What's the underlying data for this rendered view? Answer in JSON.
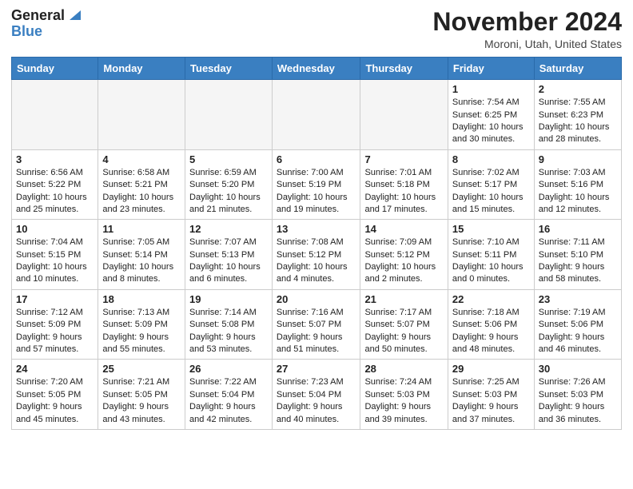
{
  "header": {
    "logo_line1": "General",
    "logo_line2": "Blue",
    "month": "November 2024",
    "location": "Moroni, Utah, United States"
  },
  "weekdays": [
    "Sunday",
    "Monday",
    "Tuesday",
    "Wednesday",
    "Thursday",
    "Friday",
    "Saturday"
  ],
  "weeks": [
    [
      {
        "day": "",
        "text": "",
        "empty": true
      },
      {
        "day": "",
        "text": "",
        "empty": true
      },
      {
        "day": "",
        "text": "",
        "empty": true
      },
      {
        "day": "",
        "text": "",
        "empty": true
      },
      {
        "day": "",
        "text": "",
        "empty": true
      },
      {
        "day": "1",
        "text": "Sunrise: 7:54 AM\nSunset: 6:25 PM\nDaylight: 10 hours and 30 minutes.",
        "empty": false
      },
      {
        "day": "2",
        "text": "Sunrise: 7:55 AM\nSunset: 6:23 PM\nDaylight: 10 hours and 28 minutes.",
        "empty": false
      }
    ],
    [
      {
        "day": "3",
        "text": "Sunrise: 6:56 AM\nSunset: 5:22 PM\nDaylight: 10 hours and 25 minutes.",
        "empty": false
      },
      {
        "day": "4",
        "text": "Sunrise: 6:58 AM\nSunset: 5:21 PM\nDaylight: 10 hours and 23 minutes.",
        "empty": false
      },
      {
        "day": "5",
        "text": "Sunrise: 6:59 AM\nSunset: 5:20 PM\nDaylight: 10 hours and 21 minutes.",
        "empty": false
      },
      {
        "day": "6",
        "text": "Sunrise: 7:00 AM\nSunset: 5:19 PM\nDaylight: 10 hours and 19 minutes.",
        "empty": false
      },
      {
        "day": "7",
        "text": "Sunrise: 7:01 AM\nSunset: 5:18 PM\nDaylight: 10 hours and 17 minutes.",
        "empty": false
      },
      {
        "day": "8",
        "text": "Sunrise: 7:02 AM\nSunset: 5:17 PM\nDaylight: 10 hours and 15 minutes.",
        "empty": false
      },
      {
        "day": "9",
        "text": "Sunrise: 7:03 AM\nSunset: 5:16 PM\nDaylight: 10 hours and 12 minutes.",
        "empty": false
      }
    ],
    [
      {
        "day": "10",
        "text": "Sunrise: 7:04 AM\nSunset: 5:15 PM\nDaylight: 10 hours and 10 minutes.",
        "empty": false
      },
      {
        "day": "11",
        "text": "Sunrise: 7:05 AM\nSunset: 5:14 PM\nDaylight: 10 hours and 8 minutes.",
        "empty": false
      },
      {
        "day": "12",
        "text": "Sunrise: 7:07 AM\nSunset: 5:13 PM\nDaylight: 10 hours and 6 minutes.",
        "empty": false
      },
      {
        "day": "13",
        "text": "Sunrise: 7:08 AM\nSunset: 5:12 PM\nDaylight: 10 hours and 4 minutes.",
        "empty": false
      },
      {
        "day": "14",
        "text": "Sunrise: 7:09 AM\nSunset: 5:12 PM\nDaylight: 10 hours and 2 minutes.",
        "empty": false
      },
      {
        "day": "15",
        "text": "Sunrise: 7:10 AM\nSunset: 5:11 PM\nDaylight: 10 hours and 0 minutes.",
        "empty": false
      },
      {
        "day": "16",
        "text": "Sunrise: 7:11 AM\nSunset: 5:10 PM\nDaylight: 9 hours and 58 minutes.",
        "empty": false
      }
    ],
    [
      {
        "day": "17",
        "text": "Sunrise: 7:12 AM\nSunset: 5:09 PM\nDaylight: 9 hours and 57 minutes.",
        "empty": false
      },
      {
        "day": "18",
        "text": "Sunrise: 7:13 AM\nSunset: 5:09 PM\nDaylight: 9 hours and 55 minutes.",
        "empty": false
      },
      {
        "day": "19",
        "text": "Sunrise: 7:14 AM\nSunset: 5:08 PM\nDaylight: 9 hours and 53 minutes.",
        "empty": false
      },
      {
        "day": "20",
        "text": "Sunrise: 7:16 AM\nSunset: 5:07 PM\nDaylight: 9 hours and 51 minutes.",
        "empty": false
      },
      {
        "day": "21",
        "text": "Sunrise: 7:17 AM\nSunset: 5:07 PM\nDaylight: 9 hours and 50 minutes.",
        "empty": false
      },
      {
        "day": "22",
        "text": "Sunrise: 7:18 AM\nSunset: 5:06 PM\nDaylight: 9 hours and 48 minutes.",
        "empty": false
      },
      {
        "day": "23",
        "text": "Sunrise: 7:19 AM\nSunset: 5:06 PM\nDaylight: 9 hours and 46 minutes.",
        "empty": false
      }
    ],
    [
      {
        "day": "24",
        "text": "Sunrise: 7:20 AM\nSunset: 5:05 PM\nDaylight: 9 hours and 45 minutes.",
        "empty": false
      },
      {
        "day": "25",
        "text": "Sunrise: 7:21 AM\nSunset: 5:05 PM\nDaylight: 9 hours and 43 minutes.",
        "empty": false
      },
      {
        "day": "26",
        "text": "Sunrise: 7:22 AM\nSunset: 5:04 PM\nDaylight: 9 hours and 42 minutes.",
        "empty": false
      },
      {
        "day": "27",
        "text": "Sunrise: 7:23 AM\nSunset: 5:04 PM\nDaylight: 9 hours and 40 minutes.",
        "empty": false
      },
      {
        "day": "28",
        "text": "Sunrise: 7:24 AM\nSunset: 5:03 PM\nDaylight: 9 hours and 39 minutes.",
        "empty": false
      },
      {
        "day": "29",
        "text": "Sunrise: 7:25 AM\nSunset: 5:03 PM\nDaylight: 9 hours and 37 minutes.",
        "empty": false
      },
      {
        "day": "30",
        "text": "Sunrise: 7:26 AM\nSunset: 5:03 PM\nDaylight: 9 hours and 36 minutes.",
        "empty": false
      }
    ]
  ],
  "accent_color": "#3a7fc1"
}
